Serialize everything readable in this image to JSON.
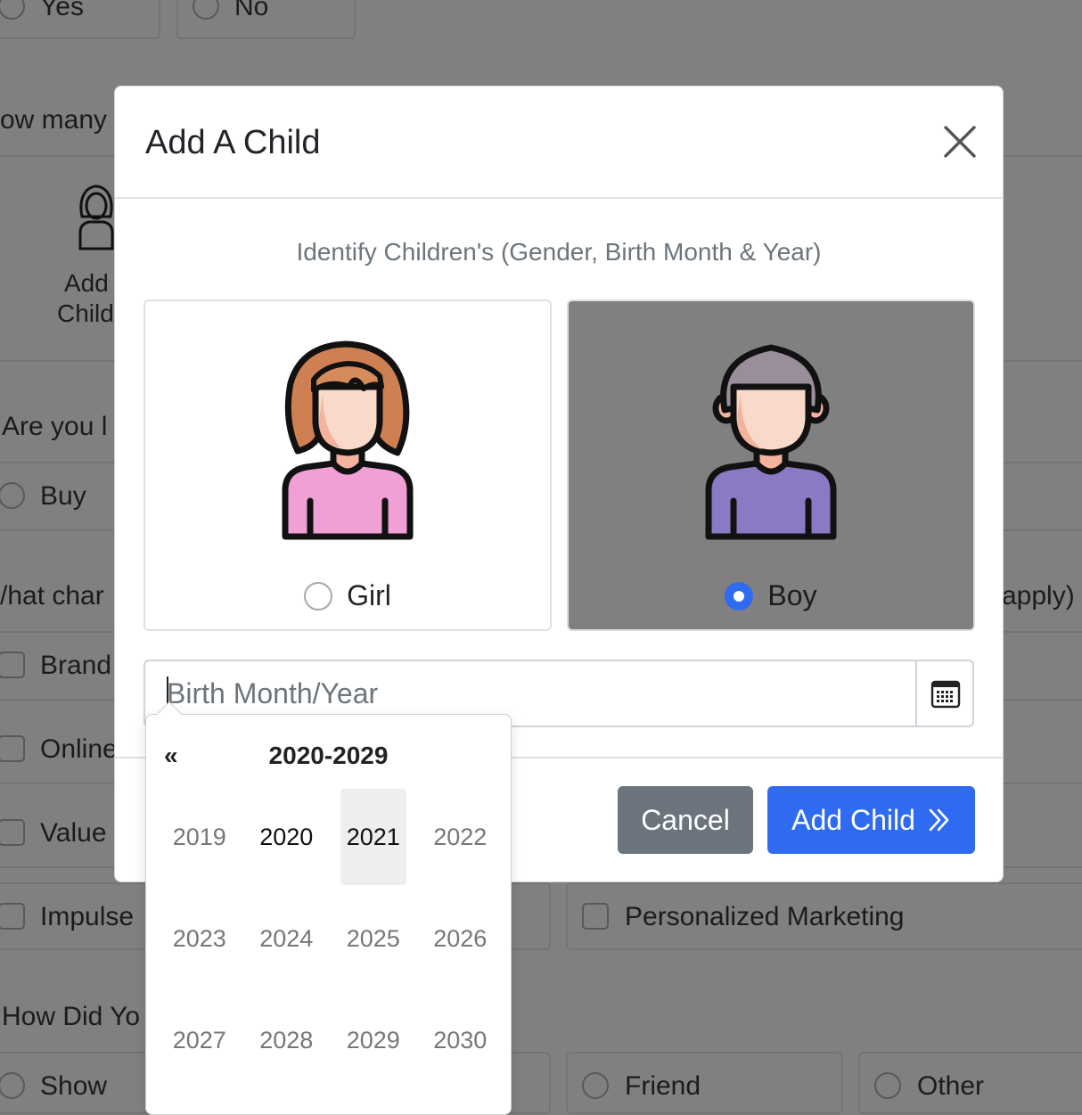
{
  "background": {
    "row1": [
      "Yes",
      "No"
    ],
    "q_how_many": "ow many",
    "add_child": [
      "Add",
      "Child"
    ],
    "q_are_you": "Are you l",
    "buy": "Buy",
    "q_what_char": "/hat char",
    "q_what_char_tail": "apply)",
    "checks": [
      "Brand",
      "Online",
      "Value",
      "Impulse",
      "Personalized Marketing"
    ],
    "q_how_did": "How Did Yo",
    "sources": [
      "Show",
      "Friend",
      "Other"
    ]
  },
  "modal": {
    "title": "Add A Child",
    "subtitle": "Identify Children's (Gender, Birth Month & Year)",
    "girl_label": "Girl",
    "boy_label": "Boy",
    "selected_gender": "Boy",
    "birth_placeholder": "Birth Month/Year",
    "birth_value": "",
    "cancel_label": "Cancel",
    "add_label": "Add Child"
  },
  "picker": {
    "prev": "«",
    "title": "2020-2029",
    "years": [
      "2019",
      "2020",
      "2021",
      "2022",
      "2023",
      "2024",
      "2025",
      "2026",
      "2027",
      "2028",
      "2029",
      "2030"
    ],
    "current_year": "2020",
    "selected_year": "2021"
  },
  "colors": {
    "primary": "#2f6bf0",
    "secondary": "#6c757d",
    "backdrop": "#808080"
  },
  "icons": [
    "close-icon",
    "girl-avatar",
    "boy-avatar",
    "calendar-icon",
    "double-chevron-right-icon"
  ]
}
